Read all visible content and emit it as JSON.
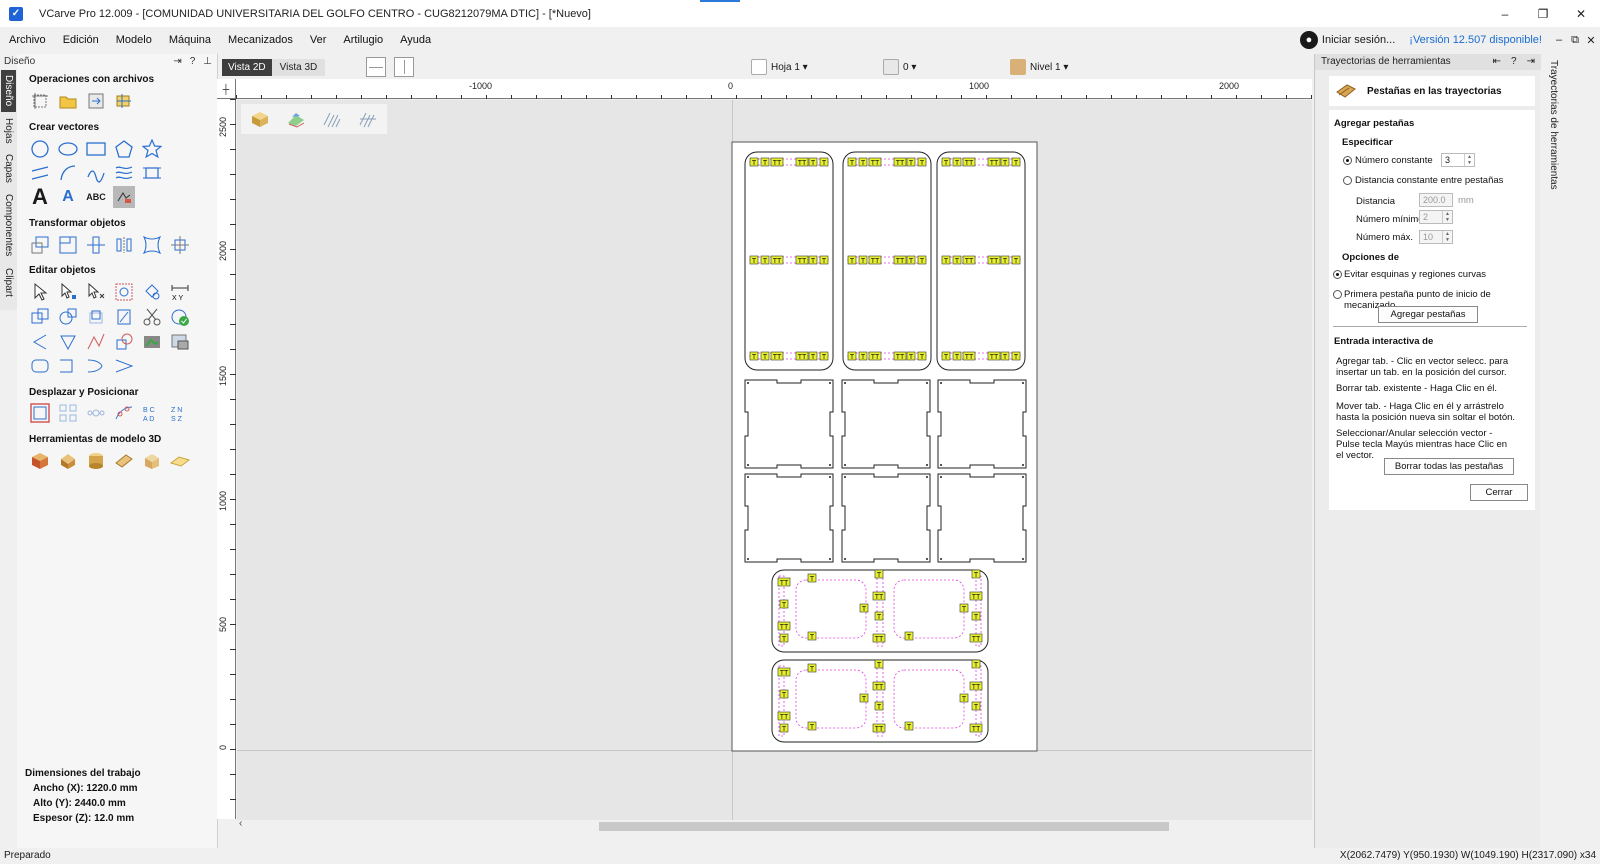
{
  "window": {
    "title": "VCarve Pro 12.009 - [COMUNIDAD UNIVERSITARIA DEL GOLFO CENTRO - CUG8212079MA DTIC] - [*Nuevo]",
    "controls": [
      "–",
      "❐",
      "✕"
    ]
  },
  "menu": {
    "items": [
      "Archivo",
      "Edición",
      "Modelo",
      "Máquina",
      "Mecanizados",
      "Ver",
      "Artilugio",
      "Ayuda"
    ],
    "login": "Iniciar sesión...",
    "version": "¡Versión 12.507 disponible!",
    "mdi": [
      "–",
      "⧉",
      "✕"
    ]
  },
  "left_tabs": [
    "Diseño",
    "Hojas",
    "Capas",
    "Componentes",
    "Clipart"
  ],
  "left_panel": {
    "header": "Diseño",
    "header_btns": [
      "⇥",
      "?",
      "⊥"
    ],
    "sections": {
      "files": "Operaciones con archivos",
      "vectors": "Crear vectores",
      "transform": "Transformar objetos",
      "edit": "Editar objetos",
      "position": "Desplazar y Posicionar",
      "model3d": "Herramientas de modelo 3D"
    },
    "text_tool_glyphs": {
      "big_a": "A",
      "small_a": "A",
      "abc": "ABC"
    },
    "job": {
      "title": "Dimensiones del trabajo",
      "width": "Ancho  (X): 1220.0 mm",
      "height": "Alto   (Y): 2440.0 mm",
      "thickness": "Espesor (Z): 12.0 mm"
    }
  },
  "view_toolbar": {
    "tab_2d": "Vista 2D",
    "tab_3d": "Vista 3D",
    "sheet": "Hoja 1 ▾",
    "zero": "0 ▾",
    "level": "Nivel 1 ▾"
  },
  "ruler": {
    "top_labels": [
      "-1000",
      "0",
      "1000",
      "2000"
    ],
    "left_labels": [
      "2500",
      "2000",
      "1500",
      "1000",
      "500",
      "0"
    ]
  },
  "right_panel": {
    "header": "Trayectorias de herramientas",
    "header_btns": [
      "⇤",
      "?",
      "⇥"
    ],
    "title": "Pestañas en las trayectorias",
    "add_tabs": "Agregar pestañas",
    "specify": "Especificar",
    "const_number": "Número constante",
    "const_number_value": "3",
    "const_distance": "Distancia constante entre pestañas",
    "distance_label": "Distancia",
    "distance_value": "200.0",
    "distance_unit": "mm",
    "min_label": "Número mínimo",
    "min_value": "2",
    "max_label": "Número máx.",
    "max_value": "10",
    "options": "Opciones de",
    "avoid_corners": "Evitar esquinas y regiones curvas",
    "first_tab": "Primera pestaña punto de inicio de mecanizado",
    "add_btn": "Agregar pestañas",
    "interactive": "Entrada interactiva de",
    "help1": "Agregar tab. - Clic en vector selecc. para insertar un tab. en la posición del cursor.",
    "help2": "Borrar tab. existente - Haga Clic en él.",
    "help3": "Mover tab. - Haga Clic en él y arrástrelo hasta la posición nueva sin soltar el botón.",
    "help4": "Seleccionar/Anular selección vector - Pulse tecla Mayús mientras hace Clic en el vector.",
    "clear_btn": "Borrar todas las pestañas",
    "close_btn": "Cerrar"
  },
  "right_vtab": "Trayectorias de herramientas",
  "canvas": {
    "tab_marker": "T",
    "tab_marker_double": "TT"
  },
  "status": {
    "left": "Preparado",
    "right": "X(2062.7479) Y(950.1930)    W(1049.190) H(2317.090) x34"
  }
}
